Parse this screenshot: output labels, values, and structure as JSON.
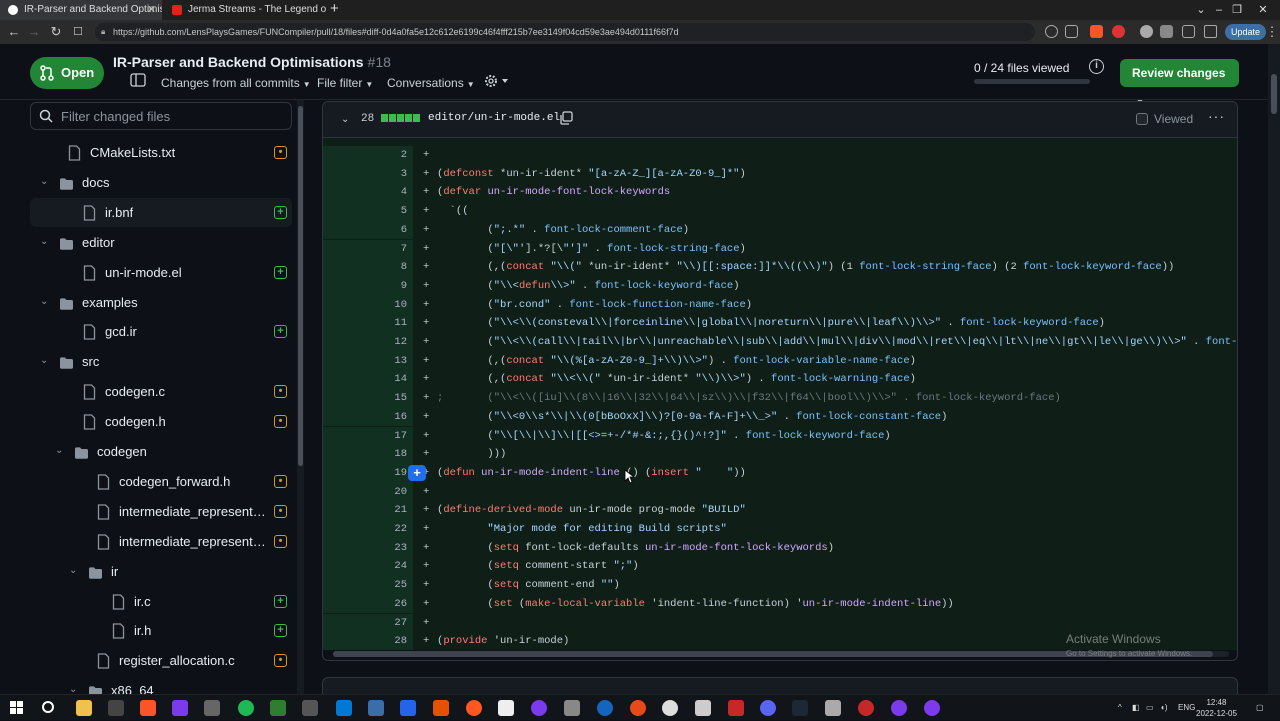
{
  "browser": {
    "tabs": [
      {
        "label": "IR-Parser and Backend Optimisatio",
        "active": true
      },
      {
        "label": "Jerma Streams - The Legend of Zelda",
        "active": false
      }
    ],
    "url": "https://github.com/LensPlaysGames/FUNCompiler/pull/18/files#diff-0d4a0fa5e12c612e6199c46f4fff215b7ee3149f04cd59e3ae494d0111f66f7d",
    "update_label": "Update"
  },
  "pr": {
    "state_label": "Open",
    "title": "IR-Parser and Backend Optimisations",
    "number": "#18",
    "changes_from_label": "Changes from",
    "changes_from_value": "all commits",
    "file_filter_label": "File filter",
    "conversations_label": "Conversations",
    "files_viewed": "0 / 24 files viewed",
    "files_viewed_fraction": 0,
    "review_label": "Review changes"
  },
  "sidebar": {
    "filter_placeholder": "Filter changed files",
    "tree": [
      {
        "type": "file",
        "name": "CMakeLists.txt",
        "status": "modified",
        "depth": 0
      },
      {
        "type": "dir",
        "name": "docs",
        "depth": 0
      },
      {
        "type": "file",
        "name": "ir.bnf",
        "status": "added",
        "depth": 1,
        "selected": true
      },
      {
        "type": "dir",
        "name": "editor",
        "depth": 0
      },
      {
        "type": "file",
        "name": "un-ir-mode.el",
        "status": "added",
        "depth": 1
      },
      {
        "type": "dir",
        "name": "examples",
        "depth": 0
      },
      {
        "type": "file",
        "name": "gcd.ir",
        "status": "added",
        "depth": 1
      },
      {
        "type": "dir",
        "name": "src",
        "depth": 0
      },
      {
        "type": "file",
        "name": "codegen.c",
        "status": "modified",
        "depth": 1
      },
      {
        "type": "file",
        "name": "codegen.h",
        "status": "modified",
        "depth": 1
      },
      {
        "type": "dir",
        "name": "codegen",
        "depth": 1
      },
      {
        "type": "file",
        "name": "codegen_forward.h",
        "status": "modified",
        "depth": 2
      },
      {
        "type": "file",
        "name": "intermediate_representatio...",
        "status": "modified",
        "depth": 2
      },
      {
        "type": "file",
        "name": "intermediate_representatio...",
        "status": "modified",
        "depth": 2
      },
      {
        "type": "dir",
        "name": "ir",
        "depth": 2
      },
      {
        "type": "file",
        "name": "ir.c",
        "status": "added",
        "depth": 3
      },
      {
        "type": "file",
        "name": "ir.h",
        "status": "added",
        "depth": 3
      },
      {
        "type": "file",
        "name": "register_allocation.c",
        "status": "modified",
        "depth": 2
      },
      {
        "type": "dir",
        "name": "x86_64",
        "depth": 2
      }
    ]
  },
  "diff": {
    "changes_count": "28",
    "file_path": "editor/un-ir-mode.el",
    "viewed_label": "Viewed",
    "lines": [
      {
        "n": "2",
        "sign": "+",
        "text": ""
      },
      {
        "n": "3",
        "sign": "+",
        "text": "(defconst *un-ir-ident* \"[a-zA-Z_][a-zA-Z0-9_]*\")"
      },
      {
        "n": "4",
        "sign": "+",
        "text": "(defvar un-ir-mode-font-lock-keywords"
      },
      {
        "n": "5",
        "sign": "+",
        "text": "  `(("
      },
      {
        "n": "6",
        "sign": "+",
        "text": "        (\";.*\" . font-lock-comment-face)"
      },
      {
        "n": "7",
        "sign": "+",
        "text": "        (\"[\\\"'].*?[\\\"']\" . font-lock-string-face)"
      },
      {
        "n": "8",
        "sign": "+",
        "text": "        (,(concat \"\\\\(\" *un-ir-ident* \"\\\\)[[:space:]]*\\\\((\\\\)\") (1 font-lock-string-face) (2 font-lock-keyword-face))"
      },
      {
        "n": "9",
        "sign": "+",
        "text": "        (\"\\\\<defun\\\\>\" . font-lock-keyword-face)"
      },
      {
        "n": "10",
        "sign": "+",
        "text": "        (\"br.cond\" . font-lock-function-name-face)"
      },
      {
        "n": "11",
        "sign": "+",
        "text": "        (\"\\\\<\\\\(consteval\\\\|forceinline\\\\|global\\\\|noreturn\\\\|pure\\\\|leaf\\\\)\\\\>\" . font-lock-keyword-face)"
      },
      {
        "n": "12",
        "sign": "+",
        "text": "        (\"\\\\<\\\\(call\\\\|tail\\\\|br\\\\|unreachable\\\\|sub\\\\|add\\\\|mul\\\\|div\\\\|mod\\\\|ret\\\\|eq\\\\|lt\\\\|ne\\\\|gt\\\\|le\\\\|ge\\\\)\\\\>\" . font-lock-keyword-face)"
      },
      {
        "n": "13",
        "sign": "+",
        "text": "        (,(concat \"\\\\(%[a-zA-Z0-9_]+\\\\)\\\\>\") . font-lock-variable-name-face)"
      },
      {
        "n": "14",
        "sign": "+",
        "text": "        (,(concat \"\\\\<\\\\(\" *un-ir-ident* \"\\\\)\\\\>\") . font-lock-warning-face)"
      },
      {
        "n": "15",
        "sign": "+",
        "text": ";       (\"\\\\<\\\\([iu]\\\\(8\\\\|16\\\\|32\\\\|64\\\\|sz\\\\)\\\\|f32\\\\|f64\\\\|bool\\\\)\\\\>\" . font-lock-keyword-face)",
        "comment": true
      },
      {
        "n": "16",
        "sign": "+",
        "text": "        (\"\\\\<0\\\\s*\\\\|\\\\(0[bBoOxX]\\\\)?[0-9a-fA-F]+\\\\_>\" . font-lock-constant-face)"
      },
      {
        "n": "17",
        "sign": "+",
        "text": "        (\"\\\\[\\\\|\\\\]\\\\|[[<>=+-/*#-&:;,{}()^!?]\" . font-lock-keyword-face)"
      },
      {
        "n": "18",
        "sign": "+",
        "text": "        )))"
      },
      {
        "n": "19",
        "sign": "+",
        "text": "(defun un-ir-mode-indent-line () (insert \"    \"))"
      },
      {
        "n": "20",
        "sign": "+",
        "text": ""
      },
      {
        "n": "21",
        "sign": "+",
        "text": "(define-derived-mode un-ir-mode prog-mode \"BUILD\""
      },
      {
        "n": "22",
        "sign": "+",
        "text": "        \"Major mode for editing Build scripts\""
      },
      {
        "n": "23",
        "sign": "+",
        "text": "        (setq font-lock-defaults un-ir-mode-font-lock-keywords)"
      },
      {
        "n": "24",
        "sign": "+",
        "text": "        (setq comment-start \";\")"
      },
      {
        "n": "25",
        "sign": "+",
        "text": "        (setq comment-end \"\")"
      },
      {
        "n": "26",
        "sign": "+",
        "text": "        (set (make-local-variable 'indent-line-function) 'un-ir-mode-indent-line))"
      },
      {
        "n": "27",
        "sign": "+",
        "text": ""
      },
      {
        "n": "28",
        "sign": "+",
        "text": "(provide 'un-ir-mode)"
      }
    ]
  },
  "overlay": {
    "activate_title": "Activate Windows",
    "activate_sub": "Go to Settings to activate Windows."
  },
  "taskbar": {
    "lang": "ENG",
    "time": "12:48",
    "date": "2022-12-05"
  },
  "colors": {
    "accent_green": "#238636",
    "added_bg": "#0f1f17",
    "modified": "#d29922",
    "added": "#3fb950"
  }
}
